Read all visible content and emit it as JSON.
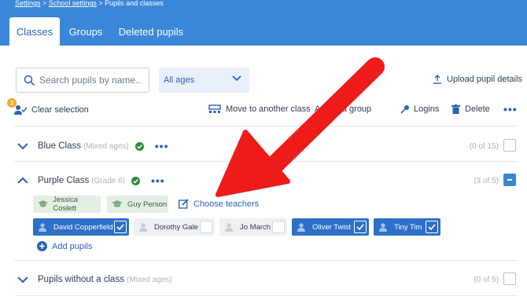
{
  "breadcrumb": {
    "items": [
      "Settings",
      "School settings",
      "Pupils and classes"
    ],
    "separator": ">"
  },
  "tabs": [
    {
      "label": "Classes",
      "active": true
    },
    {
      "label": "Groups",
      "active": false
    },
    {
      "label": "Deleted pupils",
      "active": false
    }
  ],
  "search": {
    "placeholder": "Search pupils by name...",
    "value": ""
  },
  "age_filter": {
    "selected": "All ages"
  },
  "upload": {
    "label": "Upload pupil details"
  },
  "toolbar": {
    "selection_count": "3",
    "clear_selection": "Clear selection",
    "move_class": "Move to another class",
    "add_group": "Add to a group",
    "logins": "Logins",
    "delete": "Delete"
  },
  "classes": [
    {
      "name": "Blue Class",
      "sub": "(Mixed ages)",
      "count": "(0 of 15)",
      "expanded": false
    },
    {
      "name": "Purple Class",
      "sub": "(Grade 6)",
      "count": "(3 of 5)",
      "expanded": true
    },
    {
      "name": "Pupils without a class",
      "sub": "(Mixed ages)",
      "count": "(0 of 5)",
      "expanded": false
    }
  ],
  "teachers": [
    "Jessica Coslett",
    "Guy Person"
  ],
  "choose_teachers": "Choose teachers",
  "pupils": [
    {
      "name": "David Copperfield",
      "selected": true
    },
    {
      "name": "Dorothy Gale",
      "selected": false
    },
    {
      "name": "Jo March",
      "selected": false
    },
    {
      "name": "Oliver Twist",
      "selected": true
    },
    {
      "name": "Tiny Tim",
      "selected": true
    }
  ],
  "add_pupils": "Add pupils",
  "colors": {
    "header": "#3a86d8",
    "accent": "#2a62b5",
    "arrow": "#ee1b1b",
    "selected_pupil": "#2e6fc9",
    "teacher_tag": "#e3efe3",
    "badge": "#f2a72a"
  }
}
